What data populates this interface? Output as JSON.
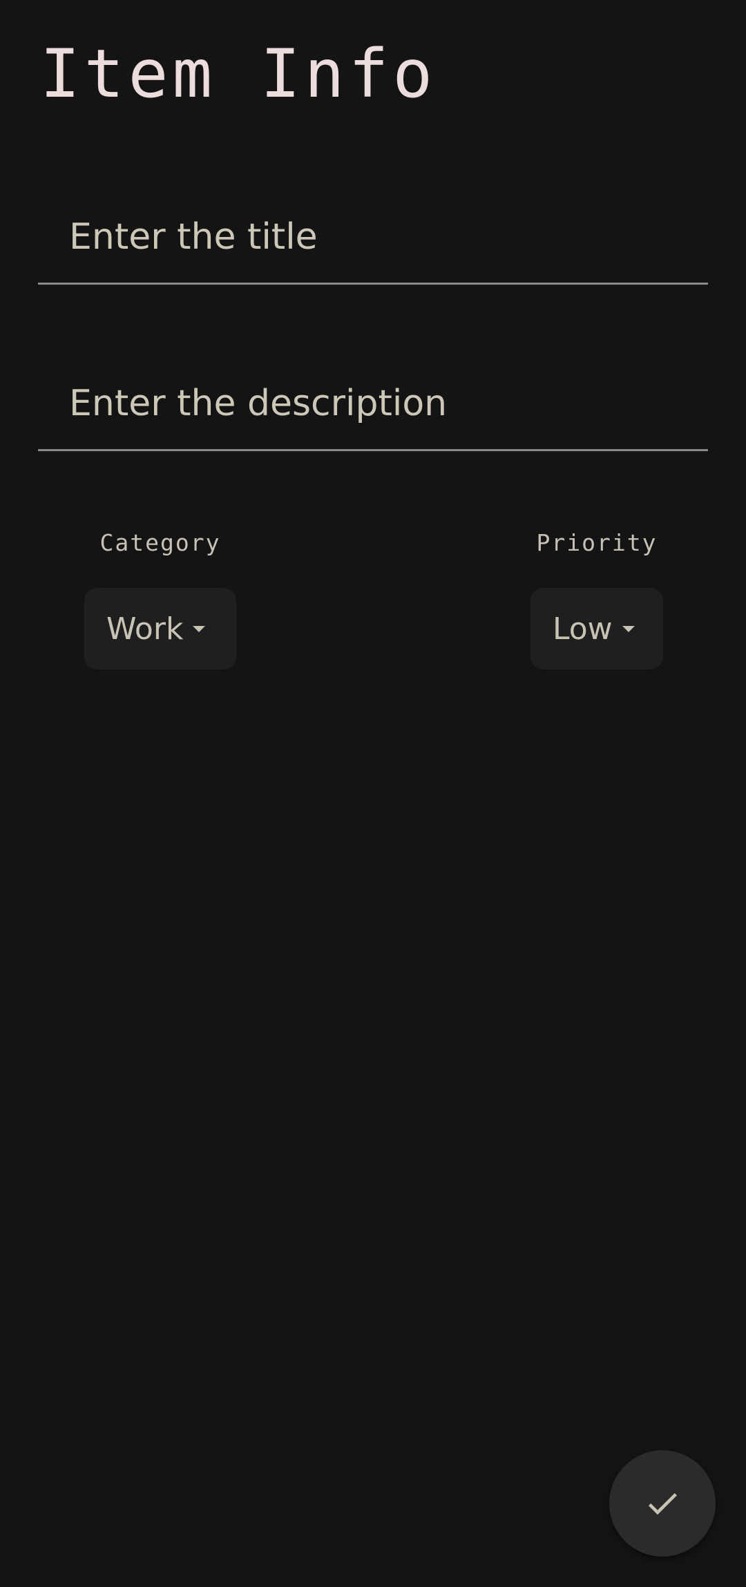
{
  "header": {
    "title": "Item Info"
  },
  "form": {
    "title_field": {
      "value": "",
      "placeholder": "Enter the title"
    },
    "description_field": {
      "value": "",
      "placeholder": "Enter the description"
    },
    "category": {
      "label": "Category",
      "selected": "Work"
    },
    "priority": {
      "label": "Priority",
      "selected": "Low"
    }
  },
  "fab": {
    "icon": "check-icon"
  },
  "colors": {
    "background": "#151414",
    "title_text": "#ecdcdc",
    "field_text": "#cdc7b8",
    "underline": "#8d8a86",
    "dropdown_bg": "#1f1f1f",
    "fab_bg": "#2b2b2b"
  }
}
